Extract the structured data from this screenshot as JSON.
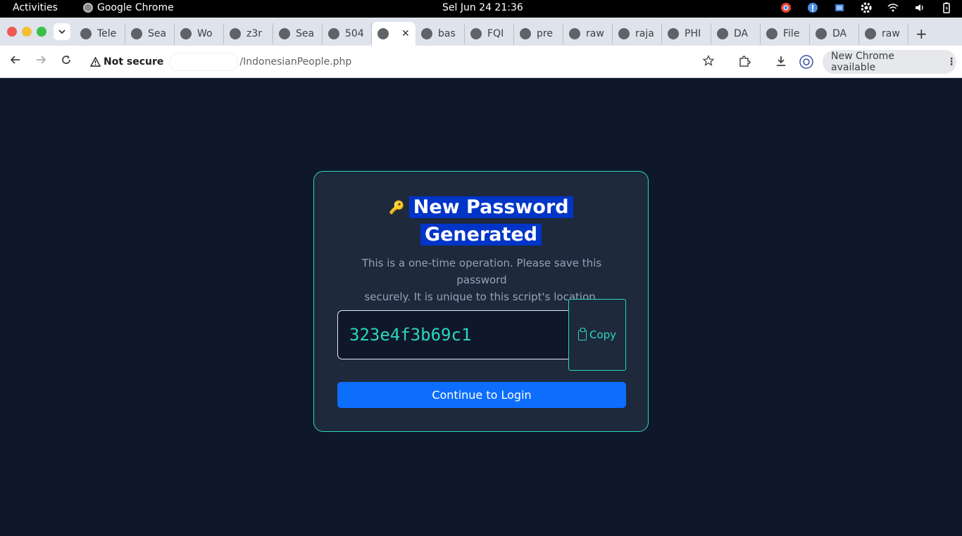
{
  "system": {
    "activities": "Activities",
    "app_name": "Google Chrome",
    "clock": "Sel Jun 24  21:36"
  },
  "browser": {
    "tabs": [
      {
        "label": "Tele",
        "icon": "telegram-icon"
      },
      {
        "label": "Sea",
        "icon": "search-site-icon"
      },
      {
        "label": "Wo",
        "icon": "globe-icon"
      },
      {
        "label": "z3r",
        "icon": "github-icon"
      },
      {
        "label": "Sea",
        "icon": "search-site-icon"
      },
      {
        "label": "504",
        "icon": "globe-icon"
      },
      {
        "label": "",
        "icon": "globe-icon",
        "active": true
      },
      {
        "label": "bas",
        "icon": "globe-icon"
      },
      {
        "label": "FQI",
        "icon": "site-icon"
      },
      {
        "label": "pre",
        "icon": "site-icon"
      },
      {
        "label": "raw",
        "icon": "globe-icon"
      },
      {
        "label": "raja",
        "icon": "globe-icon"
      },
      {
        "label": "PHI",
        "icon": "doc-icon"
      },
      {
        "label": "DA",
        "icon": "link-icon"
      },
      {
        "label": "File",
        "icon": "globe-icon"
      },
      {
        "label": "DA",
        "icon": "sheets-icon"
      },
      {
        "label": "raw",
        "icon": "globe-icon"
      }
    ],
    "security_label": "Not secure",
    "url_path": "/IndonesianPeople.php",
    "update_label": "New Chrome available"
  },
  "card": {
    "title_line1": "New Password",
    "title_line2": "Generated",
    "subtitle_line1": "This is a one-time operation. Please save this password",
    "subtitle_line2": "securely. It is unique to this script's location.",
    "password": "323e4f3b69c1",
    "copy_label": "Copy",
    "login_label": "Continue to Login"
  },
  "colors": {
    "page_bg": "#0f172a",
    "card_bg": "#1e293b",
    "accent": "#2dd4bf",
    "primary": "#0d6efd"
  }
}
